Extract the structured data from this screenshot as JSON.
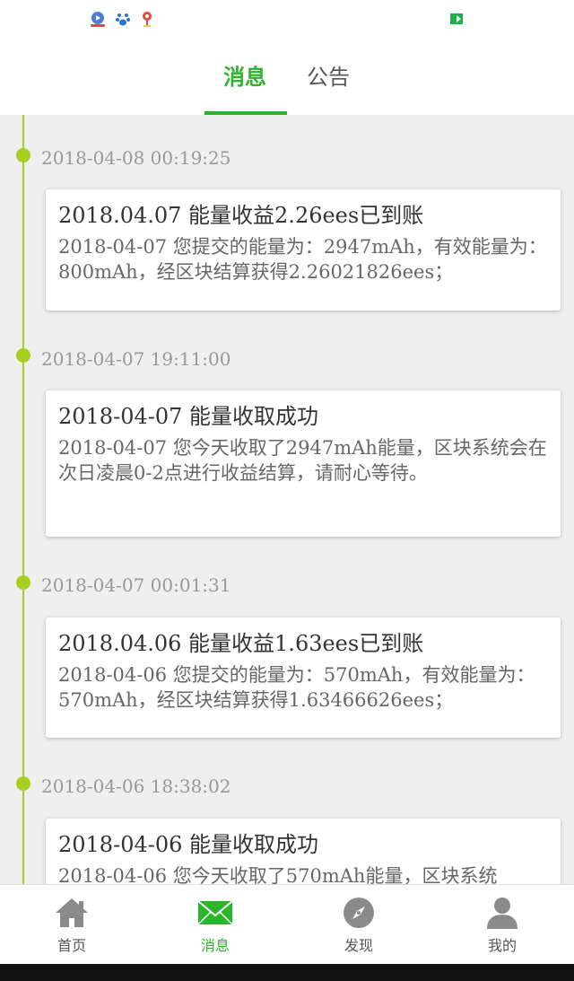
{
  "status_bar": {
    "icons": [
      "video-app-icon",
      "paw-app-icon",
      "map-pin-app-icon",
      "green-flag-icon"
    ]
  },
  "tabs": [
    {
      "label": "消息",
      "active": true
    },
    {
      "label": "公告",
      "active": false
    }
  ],
  "timeline": [
    {
      "timestamp": "2018-04-08 00:19:25",
      "title": "2018.04.07 能量收益2.26ees已到账",
      "body": "2018-04-07 您提交的能量为：2947mAh，有效能量为：800mAh，经区块结算获得2.26021826ees；"
    },
    {
      "timestamp": "2018-04-07 19:11:00",
      "title": "2018-04-07 能量收取成功",
      "body": "2018-04-07 您今天收取了2947mAh能量，区块系统会在次日凌晨0-2点进行收益结算，请耐心等待。"
    },
    {
      "timestamp": "2018-04-07 00:01:31",
      "title": "2018.04.06 能量收益1.63ees已到账",
      "body": "2018-04-06 您提交的能量为：570mAh，有效能量为：570mAh，经区块结算获得1.63466626ees；"
    },
    {
      "timestamp": "2018-04-06 18:38:02",
      "title": "2018-04-06 能量收取成功",
      "body": "2018-04-06 您今天收取了570mAh能量，区块系统"
    }
  ],
  "bottom_nav": [
    {
      "label": "首页",
      "icon": "home-icon",
      "active": false
    },
    {
      "label": "消息",
      "icon": "mail-icon",
      "active": true
    },
    {
      "label": "发现",
      "icon": "compass-icon",
      "active": false
    },
    {
      "label": "我的",
      "icon": "user-icon",
      "active": false
    }
  ],
  "colors": {
    "accent": "#2bb52b",
    "timeline": "#a6cf1e",
    "background": "#efefef",
    "inactive_icon": "#8a8a8a"
  }
}
